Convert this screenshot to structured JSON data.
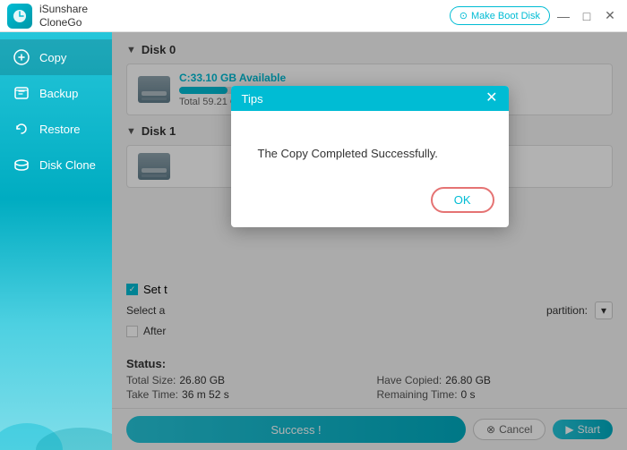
{
  "app": {
    "name_line1": "iSunshare",
    "name_line2": "CloneGo",
    "make_boot_btn": "Make Boot Disk"
  },
  "window_controls": {
    "minimize": "—",
    "maximize": "□",
    "close": "✕"
  },
  "sidebar": {
    "items": [
      {
        "id": "copy",
        "label": "Copy",
        "active": true
      },
      {
        "id": "backup",
        "label": "Backup",
        "active": false
      },
      {
        "id": "restore",
        "label": "Restore",
        "active": false
      },
      {
        "id": "diskclone",
        "label": "Disk Clone",
        "active": false
      }
    ]
  },
  "disk0": {
    "label": "Disk 0",
    "drive_name": "C:33.10 GB Available",
    "bar_fill_pct": 45,
    "total": "Total 59.21 GB"
  },
  "disk1": {
    "label": "Disk 1"
  },
  "settings": {
    "set_label": "Set t",
    "select_label": "Select a",
    "partition_label": "partition:",
    "after_label": "After"
  },
  "status": {
    "title": "Status:",
    "total_size_label": "Total Size:",
    "total_size_value": "26.80 GB",
    "have_copied_label": "Have Copied:",
    "have_copied_value": "26.80 GB",
    "take_time_label": "Take Time:",
    "take_time_value": "36 m 52 s",
    "remaining_label": "Remaining Time:",
    "remaining_value": "0 s"
  },
  "bottom_bar": {
    "success_label": "Success !",
    "cancel_label": "Cancel",
    "start_label": "Start"
  },
  "modal": {
    "title": "Tips",
    "message": "The Copy Completed Successfully.",
    "ok_label": "OK"
  }
}
